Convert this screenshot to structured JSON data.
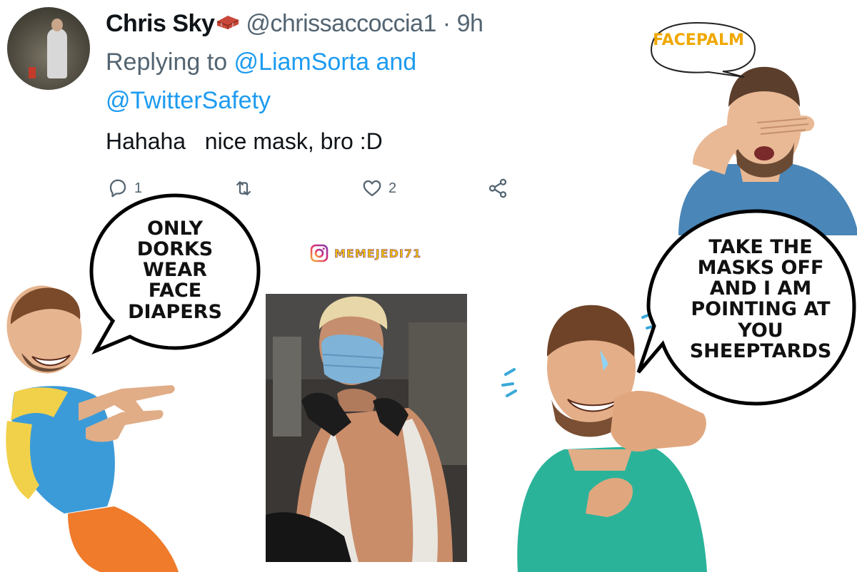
{
  "tweet": {
    "name": "Chris Sky",
    "handle": "@chrissaccoccia1 · 9h",
    "replying_prefix": "Replying to ",
    "mention_1": "@LiamSorta",
    "connector": " and",
    "mention_2": "@TwitterSafety",
    "text": "Hahaha   nice mask, bro :D",
    "reply_count": "1",
    "like_count": "2"
  },
  "bubbles": {
    "facepalm": "FACEPALM",
    "left": [
      "ONLY",
      "DORKS",
      "WEAR",
      "FACE",
      "DIAPERS"
    ],
    "right": [
      "TAKE THE",
      "MASKS OFF",
      "AND I AM",
      "POINTING AT",
      "YOU",
      "SHEEPTARDS"
    ]
  },
  "watermark": {
    "icon": "instagram-icon",
    "handle": "MEMEJEDI71"
  },
  "colors": {
    "mention": "#1d9bf0",
    "meta": "#536471",
    "facepalm": "#f0a800"
  }
}
